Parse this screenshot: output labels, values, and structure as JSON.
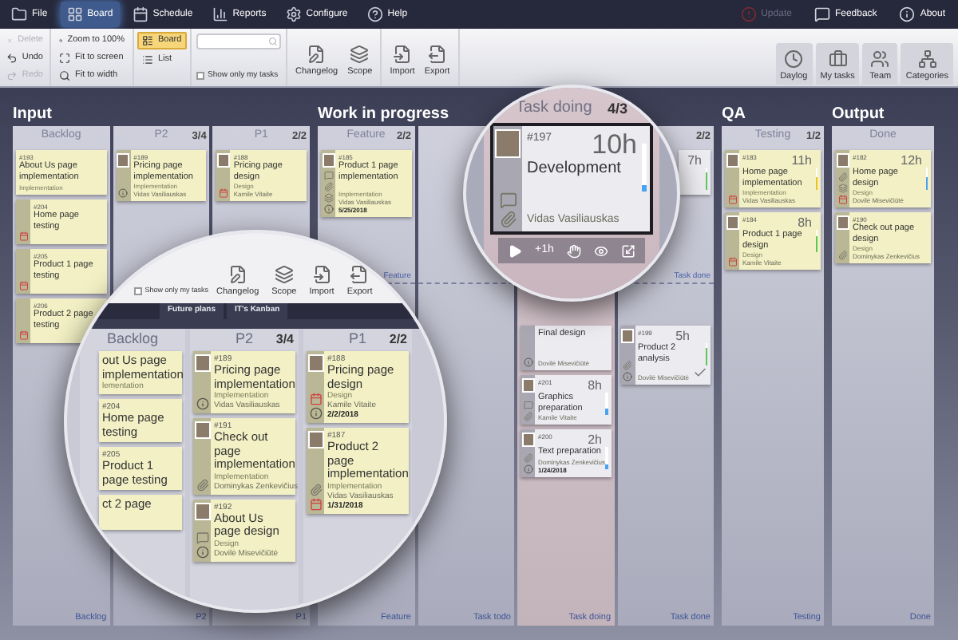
{
  "menu": [
    {
      "label": "File",
      "selected": false
    },
    {
      "label": "Board",
      "selected": true
    },
    {
      "label": "Schedule",
      "selected": false
    },
    {
      "label": "Reports",
      "selected": false
    },
    {
      "label": "Configure",
      "selected": false
    },
    {
      "label": "Help",
      "selected": false
    }
  ],
  "menu_right": [
    {
      "label": "Update",
      "disabled": true
    },
    {
      "label": "Feedback",
      "disabled": false
    },
    {
      "label": "About",
      "disabled": false
    }
  ],
  "ribbon": {
    "edit": [
      {
        "label": "Delete",
        "disabled": true
      },
      {
        "label": "Undo",
        "disabled": false
      },
      {
        "label": "Redo",
        "disabled": true
      }
    ],
    "zoom": [
      "Zoom to 100%",
      "Fit to screen",
      "Fit to width"
    ],
    "views": [
      {
        "label": "Board",
        "selected": true
      },
      {
        "label": "List",
        "selected": false
      }
    ],
    "show_only_my_tasks": {
      "label": "Show only my tasks",
      "checked": false
    },
    "actions": [
      "Changelog",
      "Scope",
      "Import",
      "Export"
    ],
    "panels": [
      "Daylog",
      "My tasks",
      "Team",
      "Categories"
    ]
  },
  "board": {
    "sections": [
      {
        "title": "Input",
        "swimlanes": false,
        "columns": [
          {
            "name": "Backlog",
            "footer": "Backlog",
            "highlighted": false,
            "cards": [
              {
                "kind": "feature",
                "id": "#193",
                "title": "About Us page implementation",
                "category": "Implementation"
              },
              {
                "kind": "feature",
                "id": "#204",
                "title": "Home page testing",
                "due_date": true
              },
              {
                "kind": "feature",
                "id": "#205",
                "title": "Product 1 page testing",
                "due_date": true
              },
              {
                "kind": "feature",
                "id": "#206",
                "title": "Product 2 page testing",
                "due_date": true
              }
            ]
          },
          {
            "name": "P2",
            "count": "3/4",
            "footer": "P2",
            "highlighted": false,
            "cards": [
              {
                "kind": "feature",
                "id": "#189",
                "title": "Pricing page implementation",
                "category": "Implementation",
                "assignee": "Vidas Vasiliauskas",
                "avatar": true,
                "note": true
              }
            ]
          },
          {
            "name": "P1",
            "count": "2/2",
            "footer": "P1",
            "highlighted": false,
            "cards": [
              {
                "kind": "feature",
                "id": "#188",
                "title": "Pricing page design",
                "category": "Design",
                "assignee": "Kamile Vitaite",
                "avatar": true,
                "due_date": true
              }
            ]
          }
        ]
      },
      {
        "title": "Work in progress",
        "swimlanes": true,
        "columns": [
          {
            "name": "Feature",
            "count": "2/2",
            "footer": "Feature",
            "highlighted": false,
            "lane_label": "Feature",
            "cards": [
              {
                "kind": "feature",
                "id": "#185",
                "title": "Product 1 page implementation",
                "category": "Implementation",
                "assignee": "Vidas Vasiliauskas",
                "date": "5/25/2018",
                "avatar": true,
                "comments": true,
                "attachments": true,
                "subtasks": true,
                "note": true
              }
            ]
          },
          {
            "footer": "Task todo",
            "highlighted": false
          },
          {
            "footer": "Task doing",
            "highlighted": true,
            "lower_cards": [
              {
                "kind": "task",
                "title": "Final design",
                "assignee": "Dovilė Misevičiūtė",
                "note": true
              },
              {
                "kind": "task",
                "id": "#201",
                "title": "Graphics preparation",
                "hours": "8h",
                "assignee": "Kamile Vitaite",
                "avatar": true,
                "comments": true,
                "attachments": true,
                "progress": {
                  "color": "#4aa3f0",
                  "level": 0.3
                }
              },
              {
                "kind": "task",
                "id": "#200",
                "title": "Text preparation",
                "hours": "2h",
                "assignee": "Dominykas Zenkevičius",
                "date": "1/24/2018",
                "avatar": true,
                "attachments": true,
                "note": true,
                "progress": {
                  "color": "#4aa3f0",
                  "level": 0.2
                }
              }
            ]
          },
          {
            "count": "2/2",
            "footer": "Task done",
            "highlighted": false,
            "lane_label": "Task done",
            "cards": [
              {
                "kind": "task",
                "hours": "7h",
                "progress": {
                  "color": "#5cc85c",
                  "level": 0.8
                }
              }
            ],
            "lower_cards": [
              {
                "kind": "task",
                "id": "#199",
                "title": "Product 2 analysis",
                "hours": "5h",
                "assignee": "Dovilė Misevičiūtė",
                "avatar": true,
                "attachments": true,
                "note": true,
                "progress": {
                  "color": "#5cc85c",
                  "level": 0.8
                },
                "done": true
              }
            ]
          }
        ]
      },
      {
        "title": "QA",
        "swimlanes": false,
        "columns": [
          {
            "name": "Testing",
            "count": "1/2",
            "footer": "Testing",
            "highlighted": false,
            "cards": [
              {
                "kind": "feature",
                "id": "#183",
                "title": "Home page implementation",
                "hours": "11h",
                "category": "Implementation",
                "assignee": "Vidas Vasiliauskas",
                "avatar": true,
                "due_date": true,
                "progress": {
                  "color": "#f0c020",
                  "level": 0.6
                }
              },
              {
                "kind": "feature",
                "id": "#184",
                "title": "Product 1 page design",
                "hours": "8h",
                "category": "Design",
                "assignee": "Kamile Vitaite",
                "avatar": true,
                "due_date": true,
                "progress": {
                  "color": "#5cc85c",
                  "level": 0.7
                }
              }
            ]
          }
        ]
      },
      {
        "title": "Output",
        "swimlanes": false,
        "columns": [
          {
            "name": "Done",
            "footer": "Done",
            "highlighted": false,
            "cards": [
              {
                "kind": "feature",
                "id": "#182",
                "title": "Home page design",
                "hours": "12h",
                "category": "Design",
                "assignee": "Dovilė Misevičiūtė",
                "avatar": true,
                "attachments": true,
                "due_date": true,
                "subtasks": true,
                "progress": {
                  "color": "#4aa3f0",
                  "level": 0.6
                }
              },
              {
                "kind": "feature",
                "id": "#190",
                "title": "Check out page design",
                "category": "Design",
                "assignee": "Dominykas Zenkevičius",
                "avatar": true,
                "attachments": true
              }
            ]
          }
        ]
      }
    ]
  },
  "magnifier_large": {
    "show_only_my_tasks": {
      "label": "Show only my tasks",
      "checked": false
    },
    "actions": [
      "Changelog",
      "Scope",
      "Import",
      "Export"
    ],
    "tabs": [
      {
        "label": "Future plans",
        "selected": false
      },
      {
        "label": "IT's Kanban",
        "selected": false
      }
    ],
    "columns": [
      {
        "name": "Backlog",
        "cards": [
          {
            "kind": "feature",
            "title": "out Us page implementation",
            "category": "lementation"
          },
          {
            "kind": "feature",
            "id": "#204",
            "title": "Home page testing"
          },
          {
            "kind": "feature",
            "id": "#205",
            "title": "Product 1 page testing"
          },
          {
            "kind": "feature",
            "title": "ct 2 page"
          }
        ]
      },
      {
        "name": "P2",
        "count": "3/4",
        "cards": [
          {
            "kind": "feature",
            "id": "#189",
            "title": "Pricing page implementation",
            "category": "Implementation",
            "assignee": "Vidas Vasiliauskas",
            "avatar": true,
            "note": true
          },
          {
            "kind": "feature",
            "id": "#191",
            "title": "Check out page implementation",
            "category": "Implementation",
            "assignee": "Dominykas Zenkevičius",
            "avatar": true,
            "attachments": true
          },
          {
            "kind": "feature",
            "id": "#192",
            "title": "About Us page design",
            "category": "Design",
            "assignee": "Dovilė Misevičiūtė",
            "avatar": true,
            "comments": true,
            "note": true
          }
        ]
      },
      {
        "name": "P1",
        "count": "2/2",
        "cards": [
          {
            "kind": "feature",
            "id": "#188",
            "title": "Pricing page design",
            "category": "Design",
            "assignee": "Kamile Vitaite",
            "date": "2/2/2018",
            "avatar": true,
            "due_date": true,
            "note": true
          },
          {
            "kind": "feature",
            "id": "#187",
            "title": "Product 2 page implementation",
            "category": "Implementation",
            "assignee": "Vidas Vasiliauskas",
            "date": "1/31/2018",
            "avatar": true,
            "attachments": true,
            "due_date": true
          }
        ]
      }
    ]
  },
  "magnifier_small": {
    "column": "Task doing",
    "count": "4/3",
    "card": {
      "kind": "task",
      "selected": true,
      "id": "#197",
      "title": "Development",
      "hours": "10h",
      "assignee": "Vidas Vasiliauskas",
      "avatar": true,
      "comments": true,
      "attachments": true,
      "progress": {
        "color": "#4aa3f0",
        "level": 0.15
      }
    },
    "add_time": "+1h"
  }
}
